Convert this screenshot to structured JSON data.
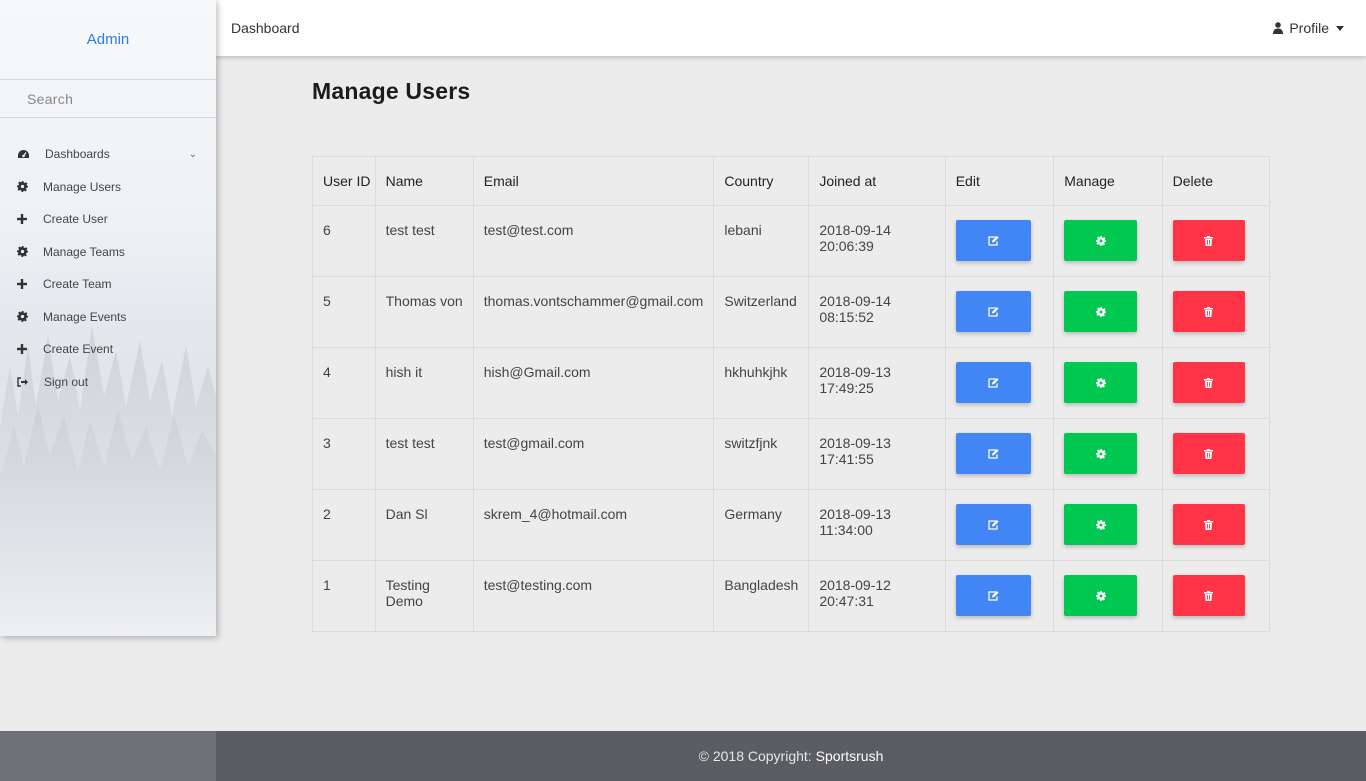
{
  "sidebar": {
    "brand": "Admin",
    "search_placeholder": "Search",
    "items": [
      {
        "label": "Dashboards",
        "icon": "dashboard-icon"
      },
      {
        "label": "Manage Users",
        "icon": "gear-icon"
      },
      {
        "label": "Create User",
        "icon": "plus-icon"
      },
      {
        "label": "Manage Teams",
        "icon": "gear-icon"
      },
      {
        "label": "Create Team",
        "icon": "plus-icon"
      },
      {
        "label": "Manage Events",
        "icon": "gear-icon"
      },
      {
        "label": "Create Event",
        "icon": "plus-icon"
      },
      {
        "label": "Sign out",
        "icon": "sign-out-icon"
      }
    ]
  },
  "topbar": {
    "breadcrumb": "Dashboard",
    "profile_label": "Profile"
  },
  "main": {
    "title": "Manage Users",
    "columns": [
      "User ID",
      "Name",
      "Email",
      "Country",
      "Joined at",
      "Edit",
      "Manage",
      "Delete"
    ],
    "rows": [
      {
        "id": "6",
        "name": "test test",
        "email": "test@test.com",
        "country": "lebani",
        "joined": "2018-09-14 20:06:39"
      },
      {
        "id": "5",
        "name": "Thomas von",
        "email": "thomas.vontschammer@gmail.com",
        "country": "Switzerland",
        "joined": "2018-09-14 08:15:52"
      },
      {
        "id": "4",
        "name": "hish it",
        "email": "hish@Gmail.com",
        "country": "hkhuhkjhk",
        "joined": "2018-09-13 17:49:25"
      },
      {
        "id": "3",
        "name": "test test",
        "email": "test@gmail.com",
        "country": "switzfjnk",
        "joined": "2018-09-13 17:41:55"
      },
      {
        "id": "2",
        "name": "Dan Sl",
        "email": "skrem_4@hotmail.com",
        "country": "Germany",
        "joined": "2018-09-13 11:34:00"
      },
      {
        "id": "1",
        "name": "Testing Demo",
        "email": "test@testing.com",
        "country": "Bangladesh",
        "joined": "2018-09-12 20:47:31"
      }
    ]
  },
  "footer": {
    "copyright": "© 2018 Copyright:",
    "link": "Sportsrush"
  },
  "colors": {
    "edit": "#4285f4",
    "manage": "#00c851",
    "delete": "#ff3547",
    "brand": "#2b7de9"
  }
}
